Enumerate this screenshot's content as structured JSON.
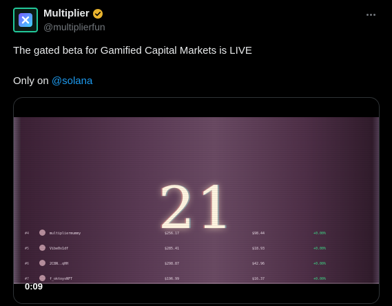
{
  "author": {
    "display_name": "Multiplier",
    "handle": "@multiplierfun",
    "verified_badge_color": "#e8b32e",
    "avatar_accent": "#22c99a"
  },
  "tweet": {
    "line1": "The gated beta for Gamified Capital Markets is LIVE",
    "line2_prefix": "Only on ",
    "line2_mention": "@solana"
  },
  "video": {
    "countdown": "21",
    "time": "0:09",
    "leaderboard": [
      {
        "rank": "#4",
        "name": "multipliermummy",
        "col1": "$256.17",
        "col2": "$98.44",
        "col3": "+0.00%"
      },
      {
        "rank": "#5",
        "name": "Vibe0x1df",
        "col1": "$285.41",
        "col2": "$18.93",
        "col3": "+0.00%"
      },
      {
        "rank": "#6",
        "name": "2C8N..qHH",
        "col1": "$298.87",
        "col2": "$42.96",
        "col3": "+0.00%"
      },
      {
        "rank": "#7",
        "name": "f_oktoysNFT",
        "col1": "$196.99",
        "col2": "$16.37",
        "col3": "+0.00%"
      }
    ]
  }
}
